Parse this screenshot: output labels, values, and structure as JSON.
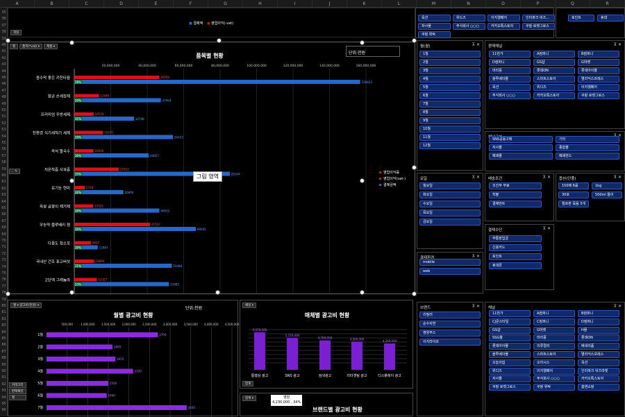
{
  "sheet": {
    "columns": [
      "A",
      "B",
      "C",
      "D",
      "E",
      "F",
      "G",
      "H",
      "I",
      "J",
      "K",
      "L",
      "M",
      "N",
      "O",
      "P",
      "Q",
      "R"
    ],
    "rows": [
      "35",
      "36",
      "37",
      "38",
      "39",
      "40",
      "41",
      "42",
      "43",
      "44",
      "45",
      "46",
      "47",
      "48",
      "49",
      "50",
      "51",
      "52",
      "53",
      "54",
      "55",
      "56",
      "57",
      "58",
      "59",
      "60",
      "61",
      "62",
      "63",
      "64",
      "65",
      "66",
      "67",
      "68",
      "69",
      "70",
      "71",
      "72",
      "73",
      "74",
      "75",
      "76",
      "77",
      "78",
      "79",
      "80",
      "81",
      "82",
      "83",
      "84",
      "85",
      "86",
      "87",
      "88",
      "89",
      "90",
      "91",
      "92",
      "93",
      "94",
      "95",
      "96"
    ]
  },
  "top_strip": {
    "btn": "객실",
    "legend": [
      "결제액",
      "영업이익(-vat)"
    ]
  },
  "product_chart": {
    "title": "품목별 현황",
    "unit": "단위:천원",
    "filter_btns": [
      "월",
      "품목(*vat) ▾",
      "제품 ▾"
    ],
    "drawing_area": "그림 영역",
    "collapse_btn": "..."
  },
  "chart_data": [
    {
      "type": "bar",
      "title": "품목별 현황",
      "series": [
        {
          "name": "영업이익률",
          "values": [
            28,
            20,
            31,
            29,
            26,
            25,
            20,
            26,
            26,
            29,
            21,
            23
          ]
        },
        {
          "name": "영업이익(-vat)",
          "values": [
            46556,
            13540,
            10578,
            15670,
            10506,
            24313,
            5708,
            10325,
            41557,
            9097,
            10890,
            12357
          ]
        },
        {
          "name": "결제금액",
          "values": [
            156823,
            47494,
            32748,
            54152,
            40827,
            85344,
            26890,
            46633,
            66645,
            12867,
            53488,
            51883
          ]
        }
      ],
      "categories": [
        "종수막 좋은 키친타월",
        "향균 손세정제",
        "프리미엄 주방세제",
        "친환경 식기세척기 세제",
        "즉석 짤국수",
        "저온착즙 사과즙",
        "유기농 현미",
        "옥살 곰팡이 제거제",
        "무농약 블루베리 잼",
        "다용도 청소포",
        "국내산 건조 표고버섯",
        "고단백 그래놀라"
      ],
      "axis_ticks": [
        "20,000,000",
        "40,000,000",
        "60,000,000",
        "80,000,000",
        "100,000,000",
        "120,000,000",
        "140,000,000",
        "160,000,000"
      ],
      "legend": [
        "영업이익률",
        "영업이익(vat-)",
        "결제금액"
      ],
      "unit": "단위:천원",
      "xlim": [
        0,
        160000
      ]
    },
    {
      "type": "bar",
      "title": "월별 광고비 현황",
      "unit": "단위:천원",
      "categories": [
        "1월",
        "2월",
        "3월",
        "4월",
        "5월",
        "6월",
        "7월"
      ],
      "values": [
        2700,
        1600,
        1670,
        2100,
        1500,
        1460,
        3400
      ],
      "axis_ticks": [
        "500,000",
        "1,000,000",
        "1,500,000",
        "2,000,000",
        "2,500,000",
        "3,000,000",
        "3,500,000",
        "4,000,000",
        "4,500,000"
      ],
      "xlim": [
        0,
        4500
      ]
    },
    {
      "type": "bar",
      "title": "매체별 광고비 현황",
      "categories": [
        "통행상 광고",
        "SNS 광고",
        "검색광고",
        "리타겟팅 광고",
        "디스플레이 광고"
      ],
      "values": [
        6070,
        5150,
        4760,
        4560,
        4260
      ],
      "data_labels": [
        "6,070,000",
        "5,150,000",
        "4,760,000",
        "4,560,000",
        "4,260,000"
      ]
    }
  ],
  "month_ad_chart": {
    "filter_btn": "월 ▾ 광고비(천원) ▾",
    "side_btns": [
      "카테고리",
      "판매채널",
      "월"
    ]
  },
  "media_chart": {
    "filter_btn": "채널 ▾",
    "bottom_btn": "합계"
  },
  "brand_chart": {
    "title": "브랜드별 광고비 현황",
    "filter_btn": "합계 ▾",
    "callout_name": "영양",
    "callout_value": "4,230,000 , 34%"
  },
  "slicers": {
    "top_channels": [
      "옥션",
      "위드즈",
      "이지웰페어",
      "인터파크 비즈...",
      "자사몰",
      "주식회사 ○○○",
      "카카오톡스토어",
      "쿠팡 로켓그로스",
      "쿠팡 위탁"
    ],
    "top_right": [
      "포인트",
      "휴대"
    ],
    "month": {
      "title": "월(월)",
      "items": [
        "1월",
        "2월",
        "3월",
        "4월",
        "5월",
        "6월",
        "7월",
        "8월",
        "9월",
        "10월",
        "11월",
        "12월"
      ]
    },
    "sales_channel": {
      "title": "판매채널",
      "items": [
        "11번가",
        "A컴퍼니",
        "B컴퍼니",
        "D컴퍼니",
        "GS샵",
        "G마켓",
        "마리몽",
        "롯데ON",
        "롯데아이몰",
        "올투베이몰",
        "스마트스토어",
        "멸리익스프레스",
        "옥션",
        "위디즈",
        "이지웰페어",
        "주식회사 ○○○",
        "카카오톡스토어",
        "쿠팡 로켓그로스"
      ]
    },
    "channel_type": {
      "title": "채널구분",
      "items": [
        "SNS공동구매",
        "기타",
        "자사몰",
        "종합몰",
        "폐쇄몰",
        "폐쇄한드"
      ]
    },
    "weekday": {
      "title": "요일",
      "items": [
        "월요일",
        "화요일",
        "수요일",
        "목요일",
        "금요일"
      ]
    },
    "delivery": {
      "title": "배송조건",
      "items": [
        "조건부 무료",
        "착불",
        "결제먼트"
      ]
    },
    "option": {
      "title": "옵션(단품)",
      "items": [
        "150매 6롤",
        "1kg",
        "30포",
        "500ml 들이",
        "철로판 묶음 3개"
      ]
    },
    "payment": {
      "title": "결제수단",
      "items": [
        "무통장입금",
        "신용카드",
        "포인트",
        "휴대폰"
      ]
    },
    "device": {
      "title": "결제환경",
      "items": [
        "mobile",
        "web"
      ]
    },
    "brand": {
      "title": "브랜드",
      "items": [
        "리필러",
        "순수자연",
        "영양부스",
        "이지라이프"
      ]
    },
    "channel": {
      "title": "채널",
      "items": [
        "11번가",
        "A컴퍼니",
        "B컴퍼니",
        "CJ온스타일",
        "C컴퍼니",
        "D컴퍼니",
        "GS샵",
        "G마켓",
        "H몰",
        "SSG몰",
        "마리몽",
        "롯데ON",
        "롯데아이몰",
        "의류컬리",
        "베네의품",
        "올투베이몰",
        "스마트스토어",
        "멸리익스프레스",
        "오늘의집",
        "오아시스",
        "옥션",
        "위디즈",
        "이지웰페어",
        "인터파크 비즈마켓",
        "자사몰",
        "주식회사 ○○○",
        "카카오톡스토어",
        "쿠팡 로켓그로스",
        "쿠팡 위탁",
        "홈앤쇼핑"
      ]
    }
  },
  "colors": {
    "red": "#e0101a",
    "blue": "#2668c7",
    "purple": "#8a2be2",
    "chip": "#0f2a66"
  }
}
